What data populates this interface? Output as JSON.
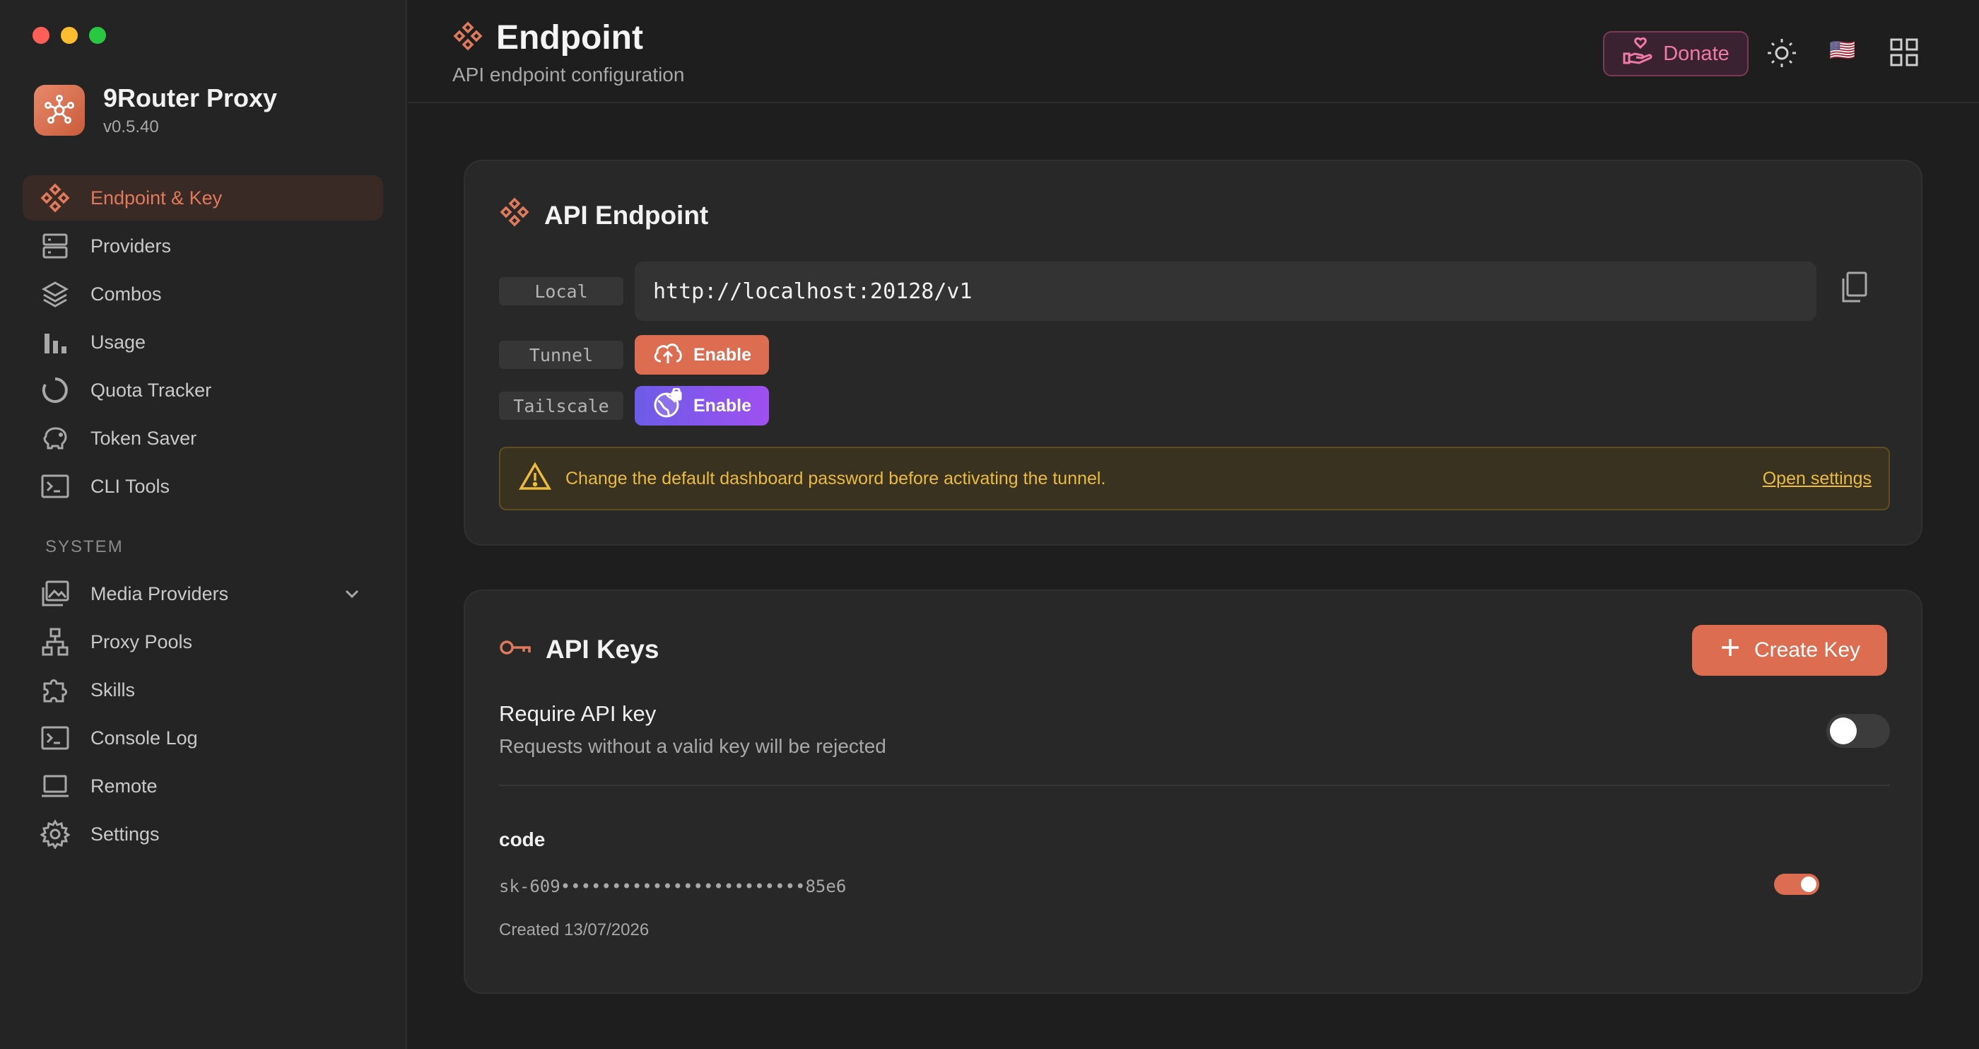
{
  "app": {
    "name": "9Router Proxy",
    "version": "v0.5.40"
  },
  "sidebar": {
    "items": [
      {
        "label": "Endpoint & Key"
      },
      {
        "label": "Providers"
      },
      {
        "label": "Combos"
      },
      {
        "label": "Usage"
      },
      {
        "label": "Quota Tracker"
      },
      {
        "label": "Token Saver"
      },
      {
        "label": "CLI Tools"
      }
    ],
    "section_label": "SYSTEM",
    "system_items": [
      {
        "label": "Media Providers"
      },
      {
        "label": "Proxy Pools"
      },
      {
        "label": "Skills"
      },
      {
        "label": "Console Log"
      },
      {
        "label": "Remote"
      },
      {
        "label": "Settings"
      }
    ]
  },
  "header": {
    "title": "Endpoint",
    "subtitle": "API endpoint configuration",
    "donate_label": "Donate",
    "flag": "🇺🇸"
  },
  "endpoint_card": {
    "title": "API Endpoint",
    "local_label": "Local",
    "local_url": "http://localhost:20128/v1",
    "tunnel_label": "Tunnel",
    "tunnel_button": "Enable",
    "tailscale_label": "Tailscale",
    "tailscale_button": "Enable",
    "warning_text": "Change the default dashboard password before activating the tunnel.",
    "warning_link": "Open settings"
  },
  "keys_card": {
    "title": "API Keys",
    "create_button": "Create Key",
    "require_title": "Require API key",
    "require_desc": "Requests without a valid key will be rejected",
    "require_enabled": false,
    "key": {
      "name": "code",
      "masked": "sk-609••••••••••••••••••••••••85e6",
      "created": "Created 13/07/2026",
      "enabled": true
    }
  },
  "colors": {
    "accent": "#dc6d50",
    "tailscale": "#7c4dff",
    "warning": "#eabb3c",
    "donate": "#f07aa8"
  }
}
